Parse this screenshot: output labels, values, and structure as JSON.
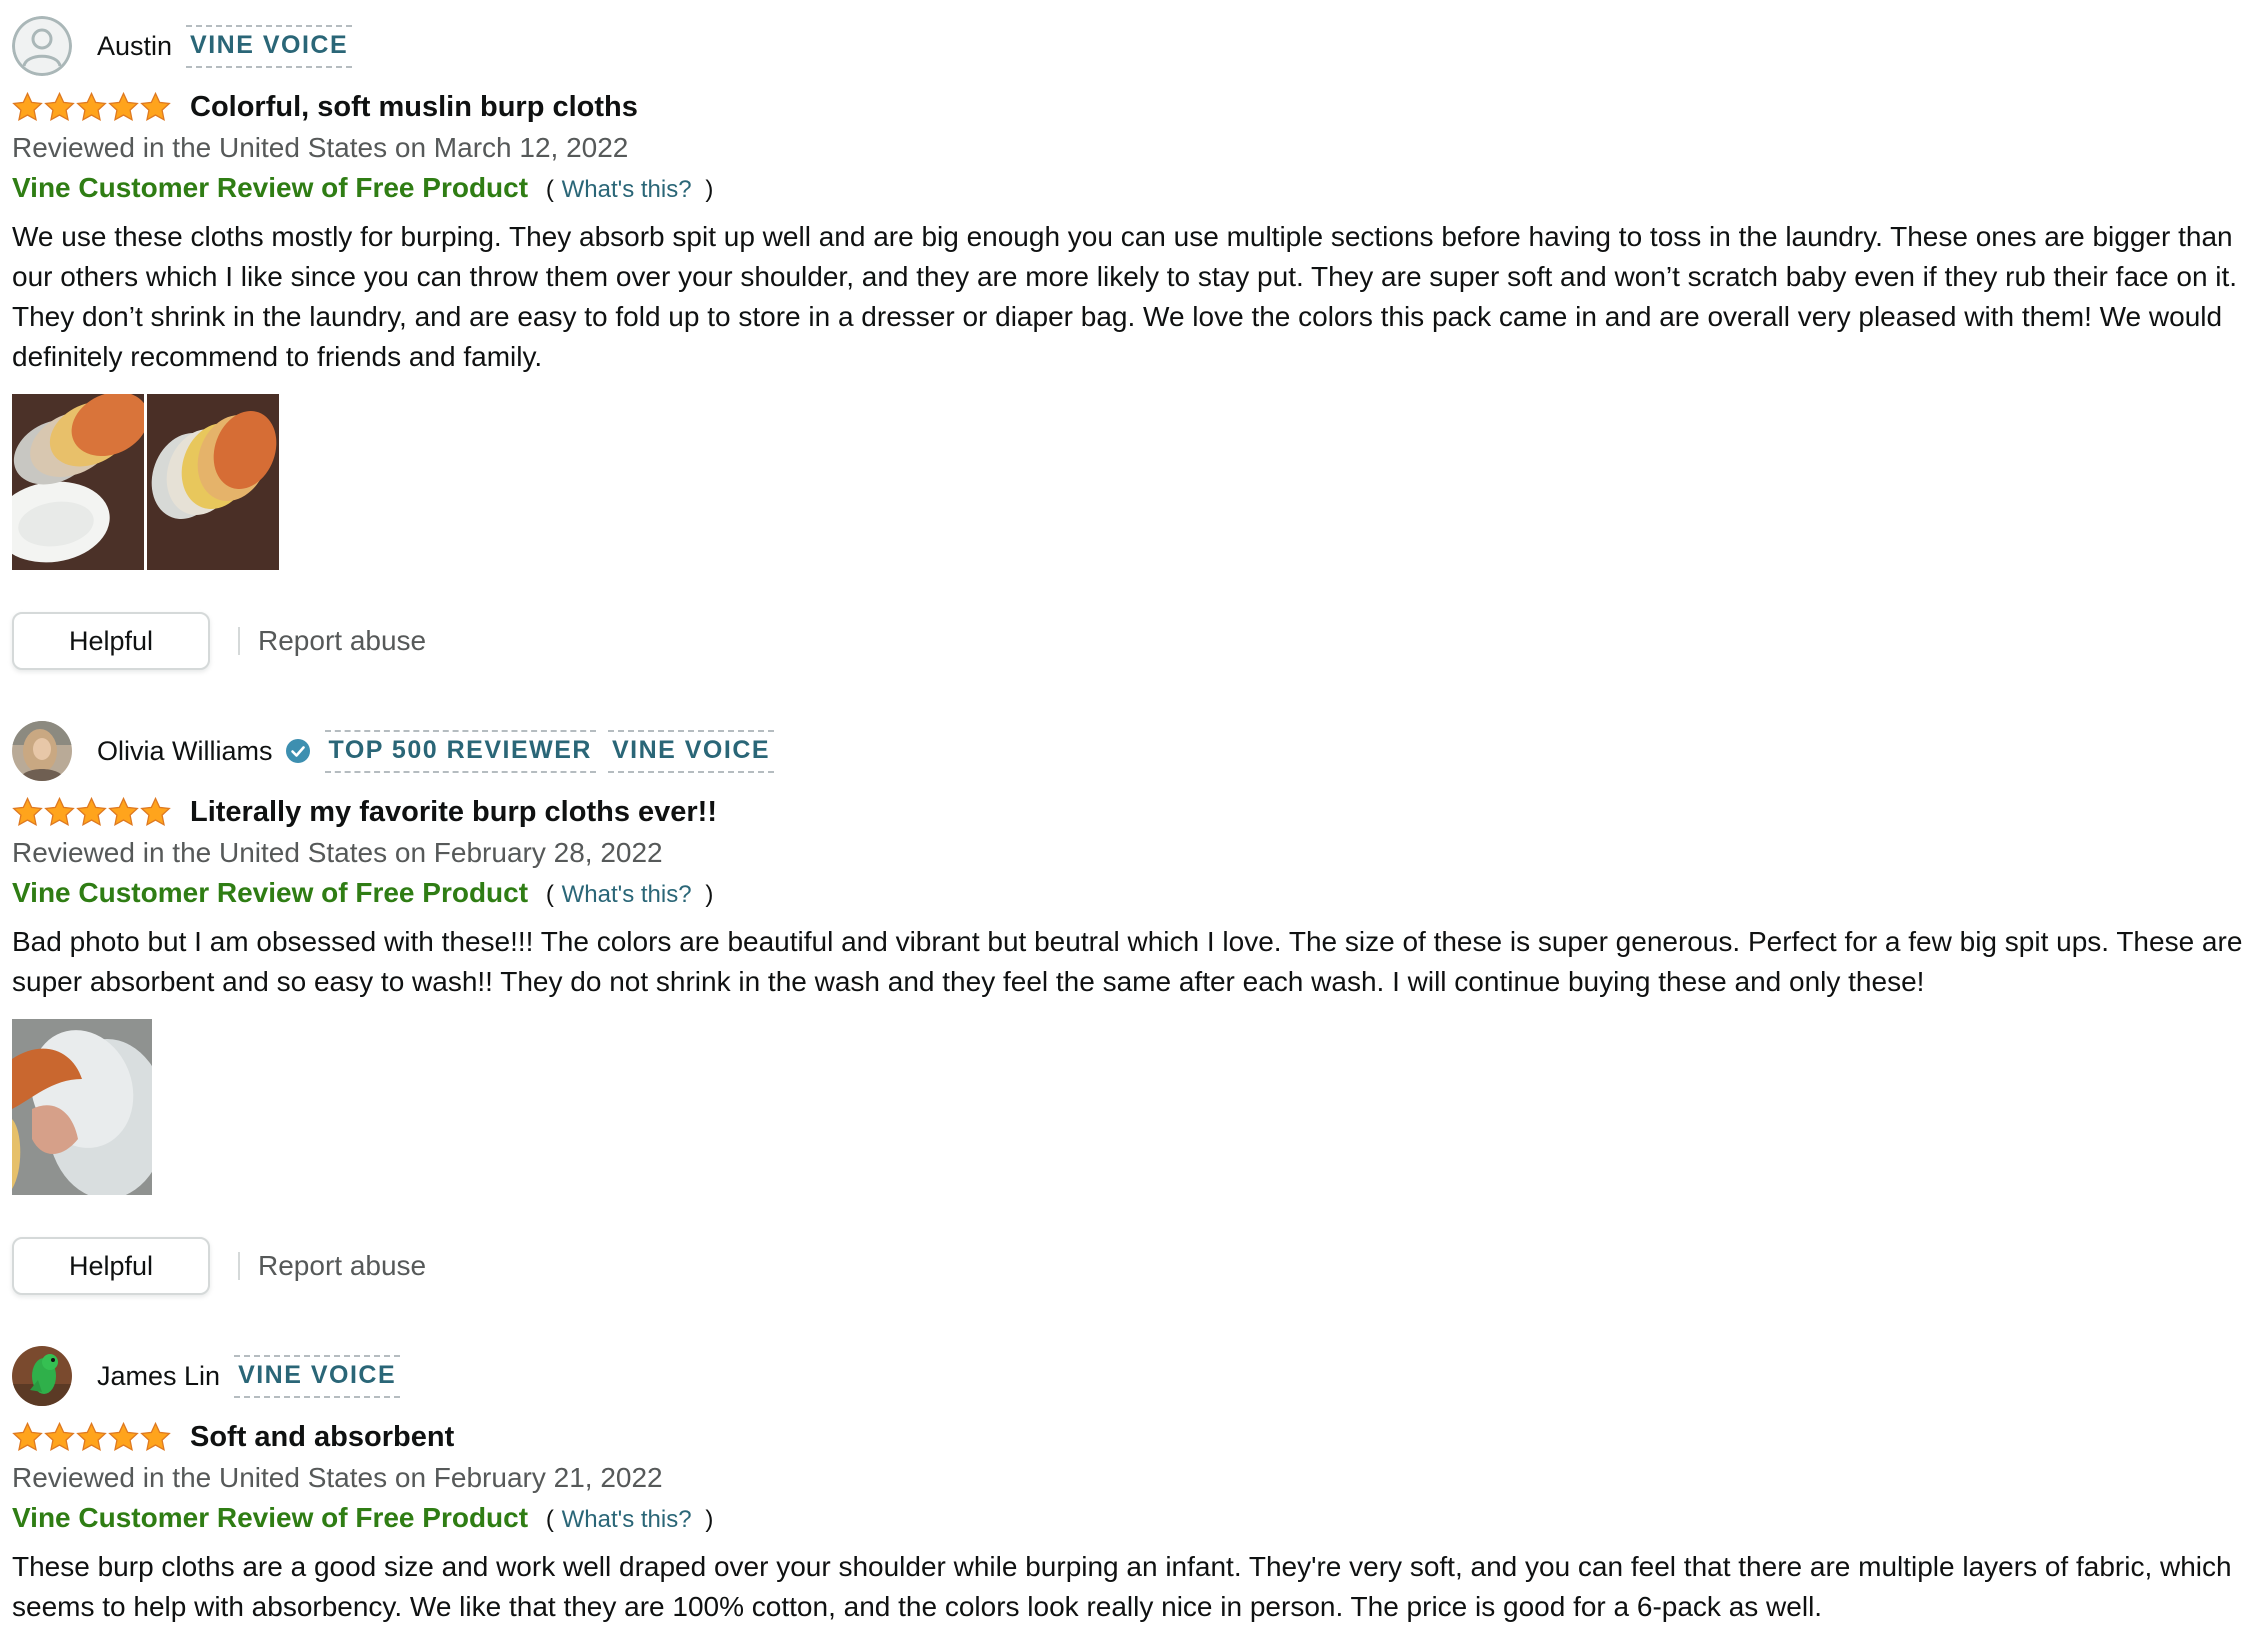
{
  "colors": {
    "star": "#ffa41c",
    "badge": "#2a6677",
    "vine_green": "#2f7d14",
    "muted": "#565959",
    "link": "#2a6677"
  },
  "reviews": [
    {
      "reviewer": "Austin",
      "avatar": "default-avatar-icon",
      "verified": false,
      "badges": [
        "VINE VOICE"
      ],
      "rating": 5,
      "title": "Colorful, soft muslin burp cloths",
      "date": "Reviewed in the United States on March 12, 2022",
      "vine_label": "Vine Customer Review of Free Product",
      "paren_open": "(",
      "whats_this": "What's this?",
      "paren_close": ")",
      "body": "We use these cloths mostly for burping. They absorb spit up well and are big enough you can use multiple sections before having to toss in the laundry. These ones are bigger than our others which I like since you can throw them over your shoulder, and they are more likely to stay put. They are super soft and won’t scratch baby even if they rub their face on it. They don’t shrink in the laundry, and are easy to fold up to store in a dresser or diaper bag. We love the colors this pack came in and are overall very pleased with them! We would definitely recommend to friends and family.",
      "photos": 2,
      "helpful_label": "Helpful",
      "report_label": "Report abuse"
    },
    {
      "reviewer": "Olivia Williams",
      "avatar": "profile-photo",
      "verified": true,
      "badges": [
        "TOP 500 REVIEWER",
        "VINE VOICE"
      ],
      "rating": 5,
      "title": "Literally my favorite burp cloths ever!!",
      "date": "Reviewed in the United States on February 28, 2022",
      "vine_label": "Vine Customer Review of Free Product",
      "paren_open": "(",
      "whats_this": "What's this?",
      "paren_close": ")",
      "body": "Bad photo but I am obsessed with these!!! The colors are beautiful and vibrant but beutral which I love. The size of these is super generous. Perfect for a few big spit ups. These are super absorbent and so easy to wash!! They do not shrink in the wash and they feel the same after each wash. I will continue buying these and only these!",
      "photos": 1,
      "helpful_label": "Helpful",
      "report_label": "Report abuse"
    },
    {
      "reviewer": "James Lin",
      "avatar": "profile-photo",
      "verified": false,
      "badges": [
        "VINE VOICE"
      ],
      "rating": 5,
      "title": "Soft and absorbent",
      "date": "Reviewed in the United States on February 21, 2022",
      "vine_label": "Vine Customer Review of Free Product",
      "paren_open": "(",
      "whats_this": "What's this?",
      "paren_close": ")",
      "body": "These burp cloths are a good size and work well draped over your shoulder while burping an infant. They're very soft, and you can feel that there are multiple layers of fabric, which seems to help with absorbency. We like that they are 100% cotton, and the colors look really nice in person. The price is good for a 6-pack as well."
    }
  ]
}
